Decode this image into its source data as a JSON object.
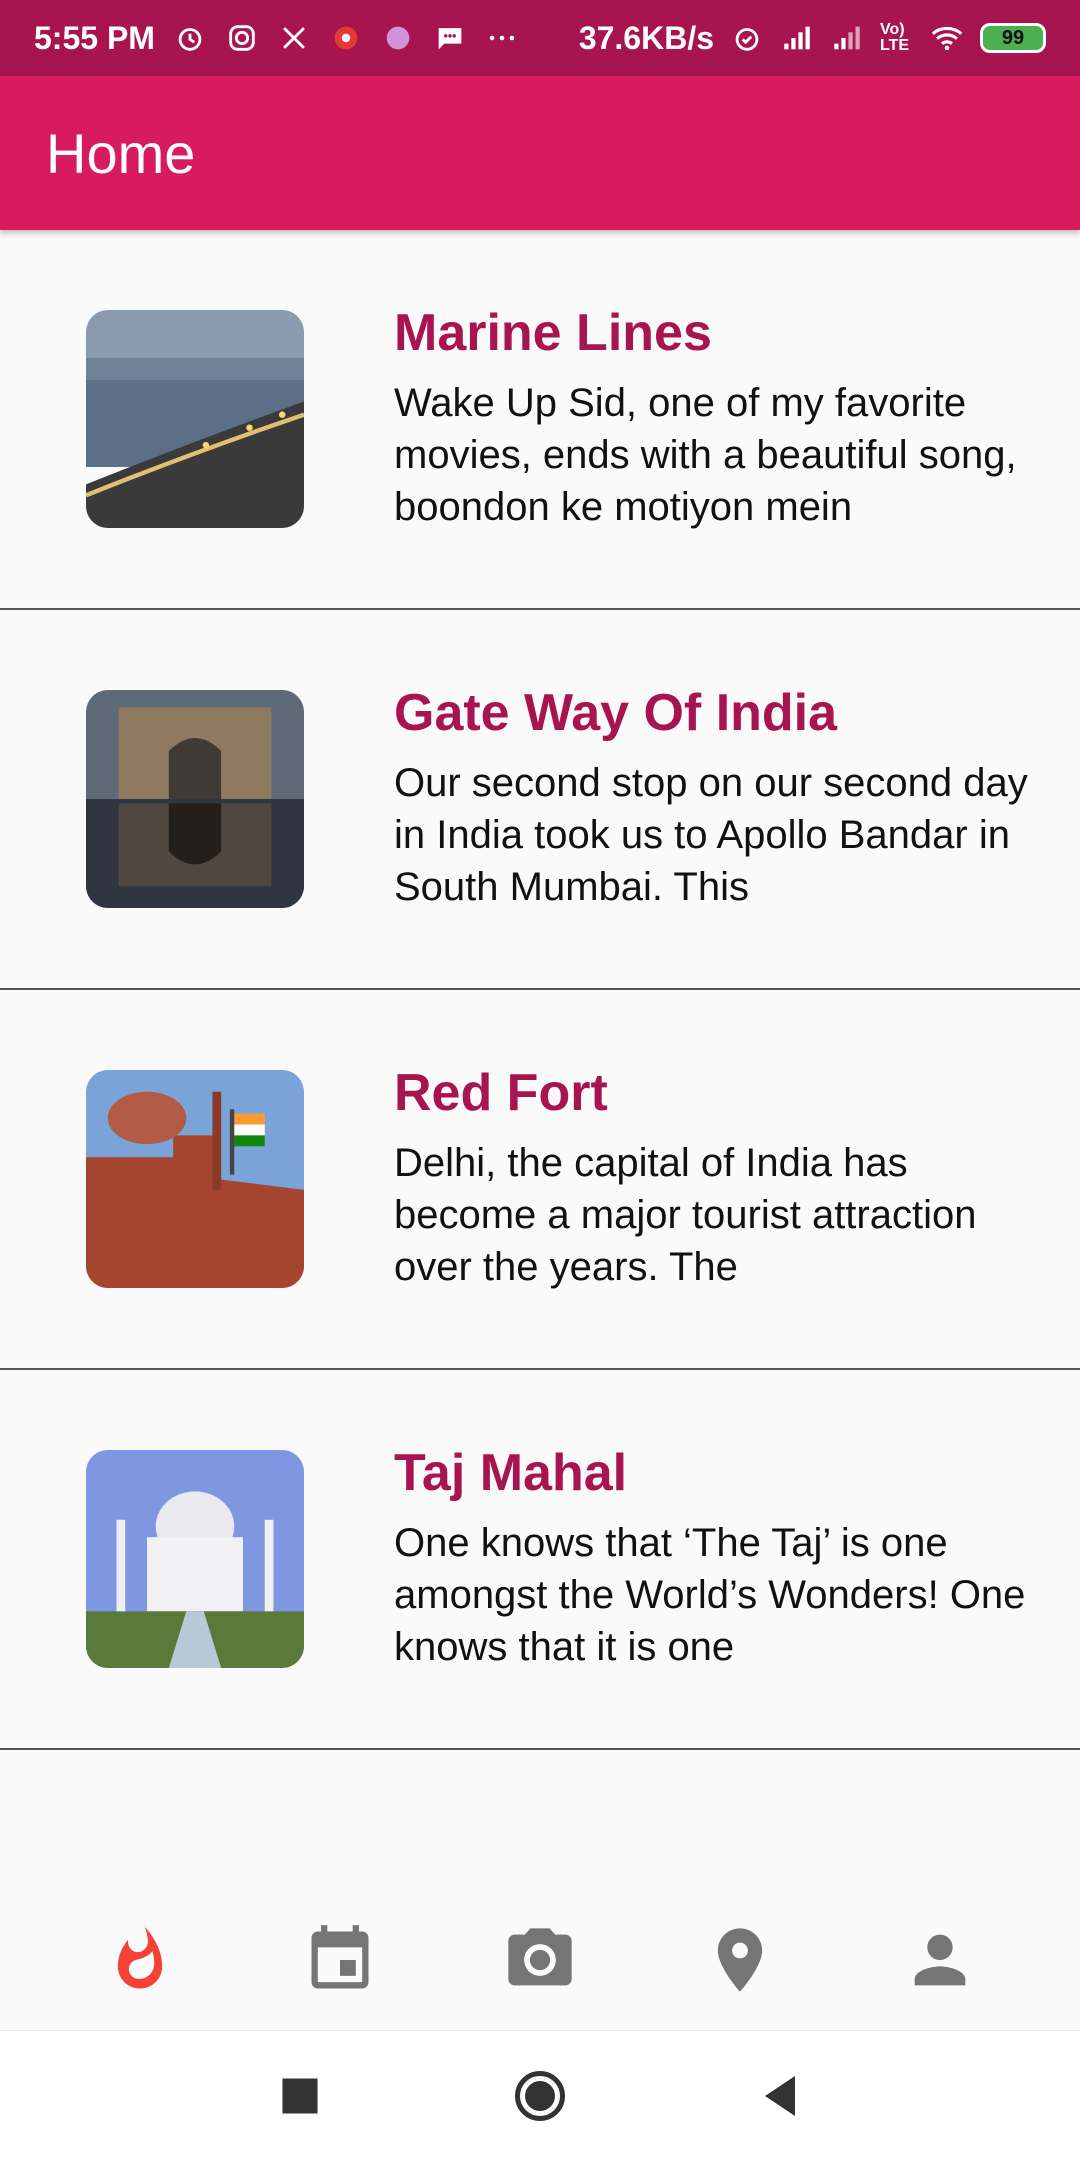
{
  "status_bar": {
    "time": "5:55 PM",
    "net_speed": "37.6KB/s",
    "battery": "99",
    "volte": "Vo) LTE"
  },
  "app_bar": {
    "title": "Home"
  },
  "list": [
    {
      "title": "Marine Lines",
      "desc": "Wake Up Sid, one of my favorite movies, ends with a beautiful song, boondon ke motiyon mein",
      "image": "marine-lines-photo"
    },
    {
      "title": "Gate Way Of India",
      "desc": "Our second stop on our second day in India took us to Apollo Bandar in South Mumbai. This",
      "image": "gateway-of-india-photo"
    },
    {
      "title": "Red Fort",
      "desc": "Delhi, the capital of India has become a major tourist attraction over the years. The",
      "image": "red-fort-photo"
    },
    {
      "title": "Taj Mahal",
      "desc": "One knows that ‘The Taj’ is one amongst the World’s Wonders! One knows that it is one",
      "image": "taj-mahal-photo"
    }
  ],
  "bottom_nav": {
    "items": [
      "flame-icon",
      "calendar-icon",
      "camera-icon",
      "location-pin-icon",
      "person-icon"
    ],
    "active_color": "#f44336",
    "inactive_color": "#757575"
  },
  "colors": {
    "status_bar": "#a8144f",
    "app_bar": "#d81b5f",
    "title_text": "#a8144f"
  }
}
